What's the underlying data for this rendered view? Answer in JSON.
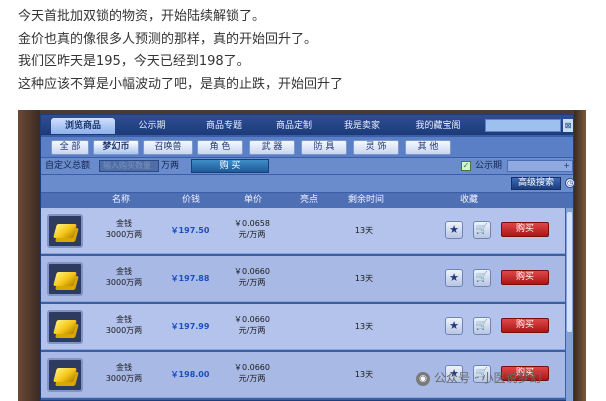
{
  "article": {
    "lines": [
      "今天首批加双锁的物资，开始陆续解锁了。",
      "金价也真的像很多人预测的那样，真的开始回升了。",
      "我们区昨天是195，今天已经到198了。",
      "这种应该不算是小幅波动了吧，是真的止跌，开始回升了"
    ]
  },
  "game": {
    "tabs": [
      "浏览商品",
      "公示期",
      "商品专题",
      "商品定制",
      "我是卖家",
      "我的藏宝阁"
    ],
    "search_button": "⊠",
    "categories": [
      "全 部",
      "梦幻币",
      "召唤兽",
      "角 色",
      "武 器",
      "防 具",
      "灵 饰",
      "其 他"
    ],
    "filter": {
      "label": "自定义总额",
      "input_placeholder": "输入购买数量",
      "unit": "万两",
      "buy_button": "购 买",
      "public_label": "公示期",
      "public_checked": "✓",
      "select_arrow": "+"
    },
    "advanced_search": "高级搜索",
    "clock_icon": "◷",
    "columns": [
      "名称",
      "价钱",
      "单价",
      "亮点",
      "剩余时间",
      "收藏"
    ],
    "rows": [
      {
        "name": "金钱",
        "amount": "3000万两",
        "price": "￥197.50",
        "unit_price": "￥0.0658",
        "unit_suffix": "元/万两",
        "time": "13天",
        "buy": "购买"
      },
      {
        "name": "金钱",
        "amount": "3000万两",
        "price": "￥197.88",
        "unit_price": "￥0.0660",
        "unit_suffix": "元/万两",
        "time": "13天",
        "buy": "购买"
      },
      {
        "name": "金钱",
        "amount": "3000万两",
        "price": "￥197.99",
        "unit_price": "￥0.0660",
        "unit_suffix": "元/万两",
        "time": "13天",
        "buy": "购买"
      },
      {
        "name": "金钱",
        "amount": "3000万两",
        "price": "￥198.00",
        "unit_price": "￥0.0660",
        "unit_suffix": "元/万两",
        "time": "13天",
        "buy": "购买"
      }
    ],
    "favorite_icon": "★",
    "cart_icon": "🛒"
  },
  "watermark": {
    "icon": "◉",
    "text": "公众号 · 小医说梦幻"
  },
  "colors": {
    "buy_button": "#c02020",
    "price_text": "#1b4fbf",
    "window_bg": "#3a5fa8"
  }
}
